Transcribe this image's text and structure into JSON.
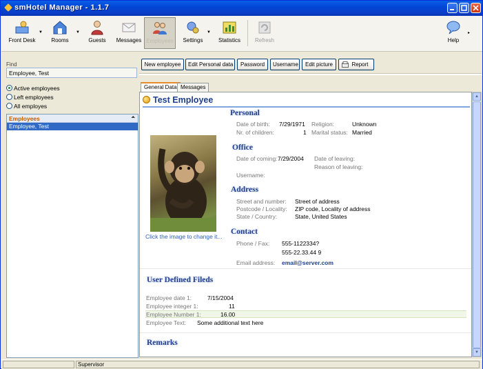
{
  "window": {
    "title": "smHotel Manager - 1.1.7"
  },
  "toolbar": {
    "items": [
      {
        "label": "Front Desk"
      },
      {
        "label": "Rooms"
      },
      {
        "label": "Guests"
      },
      {
        "label": "Messages"
      },
      {
        "label": "Employees"
      },
      {
        "label": "Settings"
      },
      {
        "label": "Statistics"
      },
      {
        "label": "Refresh"
      },
      {
        "label": "Help"
      }
    ]
  },
  "left": {
    "find_label": "Find",
    "find_value": "Employee, Test",
    "filters": [
      "Active employees",
      "Left employees",
      "All employes"
    ],
    "list_header": "Employees",
    "list_items": [
      "Employee, Test"
    ]
  },
  "actions": [
    "New employee",
    "Edit Personal data",
    "Password",
    "Username",
    "Edit picture",
    "Report"
  ],
  "tabs": [
    "General Data",
    "Messages"
  ],
  "employee": {
    "name": "Test Employee",
    "photo_caption": "Click the image to change it...",
    "personal": {
      "heading": "Personal",
      "dob_label": "Date of birth:",
      "dob": "7/29/1971",
      "religion_label": "Religion:",
      "religion": "Unknown",
      "children_label": "Nr. of children:",
      "children": "1",
      "marital_label": "Marital status:",
      "marital": "Married"
    },
    "office": {
      "heading": "Office",
      "coming_label": "Date of coming:",
      "coming": "7/29/2004",
      "leaving_label": "Date of leaving:",
      "reason_label": "Reason of leaving:",
      "username_label": "Username:"
    },
    "address": {
      "heading": "Address",
      "street_label": "Street and number:",
      "street": "Street of address",
      "postcode_label": "Postcode / Locality:",
      "postcode": "ZIP code, Locality of address",
      "state_label": "State / Country:",
      "state": "State, United States"
    },
    "contact": {
      "heading": "Contact",
      "phone_label": "Phone / Fax:",
      "phone": "555-1122334?",
      "fax": "555-22.33.44  9",
      "email_label": "Email address:",
      "email": "email@server.com"
    },
    "udf": {
      "heading": "User Defined Fileds",
      "rows": [
        {
          "label": "Employee date 1:",
          "value": "7/15/2004"
        },
        {
          "label": "Employee integer 1:",
          "value": "11"
        },
        {
          "label": "Employee Number 1:",
          "value": "16.00"
        },
        {
          "label": "Employee Text:",
          "value": "Some additional text here"
        }
      ]
    },
    "remarks_heading": "Remarks"
  },
  "status": {
    "user": "Supervisor"
  },
  "colors": {
    "titlebar": "#0a46d6",
    "heading": "#27408b",
    "selection": "#316ac5",
    "accent": "#e68b2c"
  }
}
